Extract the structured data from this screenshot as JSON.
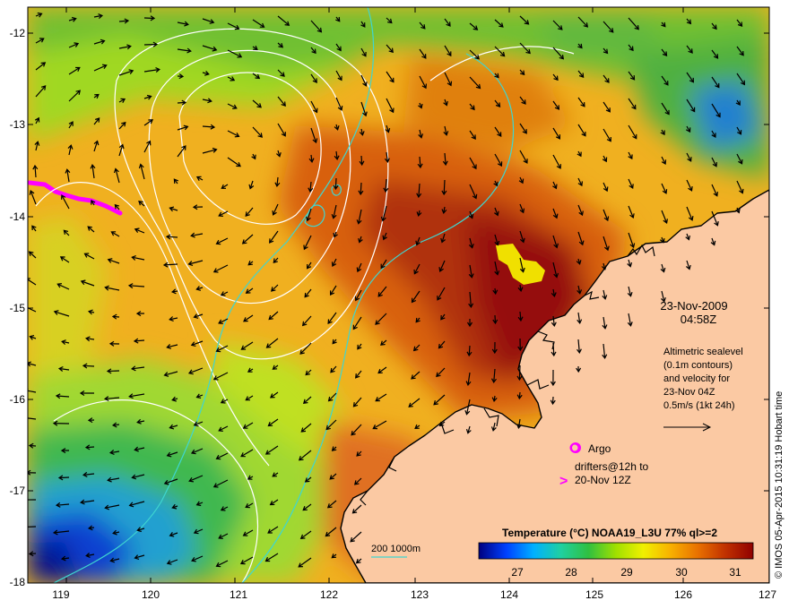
{
  "map": {
    "lon_ticks": [
      "119",
      "120",
      "121",
      "122",
      "123",
      "124",
      "125",
      "126",
      "127"
    ],
    "lat_ticks": [
      "-12",
      "-13",
      "-14",
      "-15",
      "-16",
      "-17",
      "-18"
    ],
    "date": "23-Nov-2009",
    "time": "04:58Z",
    "description_lines": [
      "Altimetric sealevel",
      "(0.1m contours)",
      "and velocity for",
      "23-Nov 04Z",
      "0.5m/s (1kt 24h)"
    ],
    "argo_label": "Argo",
    "drifters_lines": [
      "drifters@12h to",
      "20-Nov 12Z"
    ],
    "depth_label": "200  1000m",
    "colorbar": {
      "title": "Temperature (°C) NOAA19_L3U 77% ql>=2",
      "ticks": [
        "27",
        "28",
        "29",
        "30",
        "31"
      ],
      "colors": [
        "#000080",
        "#0040ff",
        "#00b0ff",
        "#20d0a0",
        "#30c040",
        "#a0e000",
        "#f0f000",
        "#f8b000",
        "#e87000",
        "#c03000",
        "#900000"
      ]
    },
    "credit": "© IMOS 05-Apr-2015 10:31:19 Hobart time",
    "colors": {
      "land": "#fbc9a3",
      "coast": "#000000",
      "isobath": "#3fd6d0",
      "contour": "#ffffff",
      "argo": "#ff00ff"
    }
  }
}
